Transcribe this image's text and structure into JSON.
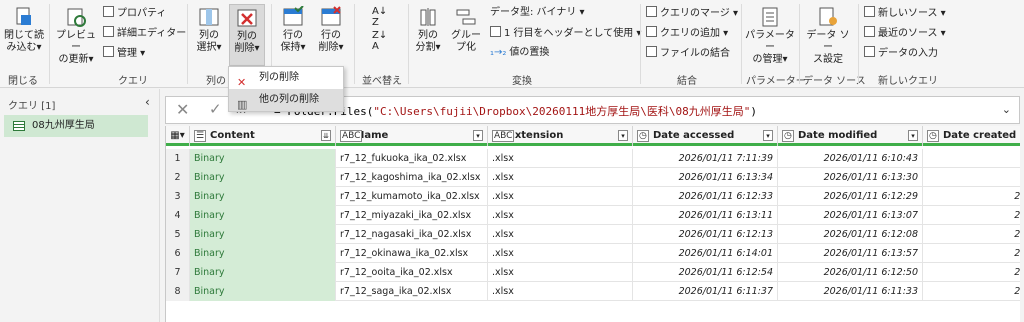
{
  "ribbon": {
    "close": {
      "label1": "閉じて読",
      "label2": "み込む▾",
      "group": "閉じる"
    },
    "preview": {
      "label1": "プレビュー",
      "label2": "の更新▾"
    },
    "properties": "プロパティ",
    "advanced_editor": "詳細エディター",
    "manage": "管理 ▾",
    "query_group": "クエリ",
    "choose_columns": {
      "label1": "列の",
      "label2": "選択▾"
    },
    "remove_columns": {
      "label1": "列の",
      "label2": "削除▾"
    },
    "columns_group": "列の",
    "keep_rows": {
      "label1": "行の",
      "label2": "保持▾"
    },
    "remove_rows": {
      "label1": "行の",
      "label2": "削除▾"
    },
    "sort_group": "並べ替え",
    "split_column": {
      "label1": "列の",
      "label2": "分割▾"
    },
    "group_by": {
      "label1": "グルー",
      "label2": "プ化"
    },
    "data_type": "データ型: バイナリ ▾",
    "use_header": "1 行目をヘッダーとして使用 ▾",
    "replace_values": "値の置換",
    "transform_group": "変換",
    "merge_queries": "クエリのマージ ▾",
    "append_queries": "クエリの追加 ▾",
    "combine_files": "ファイルの結合",
    "combine_group": "結合",
    "manage_params": {
      "label1": "パラメーター",
      "label2": "の管理▾"
    },
    "params_group": "パラメーター",
    "ds_settings": {
      "label1": "データ ソー",
      "label2": "ス設定"
    },
    "ds_group": "データ ソース",
    "new_source": "新しいソース ▾",
    "recent_sources": "最近のソース ▾",
    "enter_data": "データの入力",
    "newquery_group": "新しいクエリ"
  },
  "menu": {
    "remove_columns": "列の削除",
    "remove_other_columns": "他の列の削除"
  },
  "queries": {
    "header": "クエリ [1]",
    "items": [
      {
        "name": "08九州厚生局"
      }
    ]
  },
  "formula": {
    "fx": "fx",
    "prefix": "= Folder.Files(",
    "string": "\"C:\\Users\\fujii\\Dropbox\\20260111地方厚生局\\医科\\08九州厚生局\"",
    "suffix": ")"
  },
  "table": {
    "columns": [
      {
        "name": "Content",
        "type_icon": "☰"
      },
      {
        "name": "Name",
        "type_icon": "ABC"
      },
      {
        "name": "Extension",
        "type_icon": "ABC"
      },
      {
        "name": "Date accessed",
        "type_icon": "📅"
      },
      {
        "name": "Date modified",
        "type_icon": "📅"
      },
      {
        "name": "Date created",
        "type_icon": "📅"
      }
    ],
    "rows": [
      {
        "n": "1",
        "content": "Binary",
        "name": "r7_12_fukuoka_ika_02.xlsx",
        "ext": ".xlsx",
        "accessed": "2026/01/11 7:11:39",
        "modified": "2026/01/11 6:10:43",
        "created": "2025/12/"
      },
      {
        "n": "2",
        "content": "Binary",
        "name": "r7_12_kagoshima_ika_02.xlsx",
        "ext": ".xlsx",
        "accessed": "2026/01/11 6:13:34",
        "modified": "2026/01/11 6:13:30",
        "created": "2025/12/"
      },
      {
        "n": "3",
        "content": "Binary",
        "name": "r7_12_kumamoto_ika_02.xlsx",
        "ext": ".xlsx",
        "accessed": "2026/01/11 6:12:33",
        "modified": "2026/01/11 6:12:29",
        "created": "2025/12/0"
      },
      {
        "n": "4",
        "content": "Binary",
        "name": "r7_12_miyazaki_ika_02.xlsx",
        "ext": ".xlsx",
        "accessed": "2026/01/11 6:13:11",
        "modified": "2026/01/11 6:13:07",
        "created": "2025/12/0"
      },
      {
        "n": "5",
        "content": "Binary",
        "name": "r7_12_nagasaki_ika_02.xlsx",
        "ext": ".xlsx",
        "accessed": "2026/01/11 6:12:13",
        "modified": "2026/01/11 6:12:08",
        "created": "2025/12/0"
      },
      {
        "n": "6",
        "content": "Binary",
        "name": "r7_12_okinawa_ika_02.xlsx",
        "ext": ".xlsx",
        "accessed": "2026/01/11 6:14:01",
        "modified": "2026/01/11 6:13:57",
        "created": "2025/12/0"
      },
      {
        "n": "7",
        "content": "Binary",
        "name": "r7_12_ooita_ika_02.xlsx",
        "ext": ".xlsx",
        "accessed": "2026/01/11 6:12:54",
        "modified": "2026/01/11 6:12:50",
        "created": "2025/12/0"
      },
      {
        "n": "8",
        "content": "Binary",
        "name": "r7_12_saga_ika_02.xlsx",
        "ext": ".xlsx",
        "accessed": "2026/01/11 6:11:37",
        "modified": "2026/01/11 6:11:33",
        "created": "2025/12/0"
      }
    ]
  }
}
